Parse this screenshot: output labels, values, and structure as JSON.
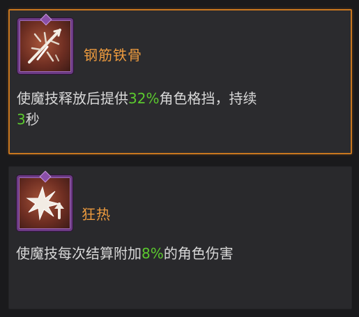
{
  "cards": [
    {
      "name": "钢筋铁骨",
      "icon": "crossed-blades-icon",
      "desc": {
        "p1": "使魔技释放后提供",
        "v1": "32%",
        "p2": "角色格挡，持续",
        "v2": "3",
        "p3": "秒"
      },
      "selected": true
    },
    {
      "name": "狂热",
      "icon": "starburst-up-arrow-icon",
      "desc": {
        "p1": "使魔技每次结算附加",
        "v1": "8%",
        "p2": "的角色伤害"
      },
      "selected": false
    }
  ],
  "colors": {
    "selected_border": "#c9771f",
    "name": "#ec9a3e",
    "highlight": "#5bc92e",
    "text": "#d8d8d8",
    "icon_frame": "#6c3a84"
  }
}
